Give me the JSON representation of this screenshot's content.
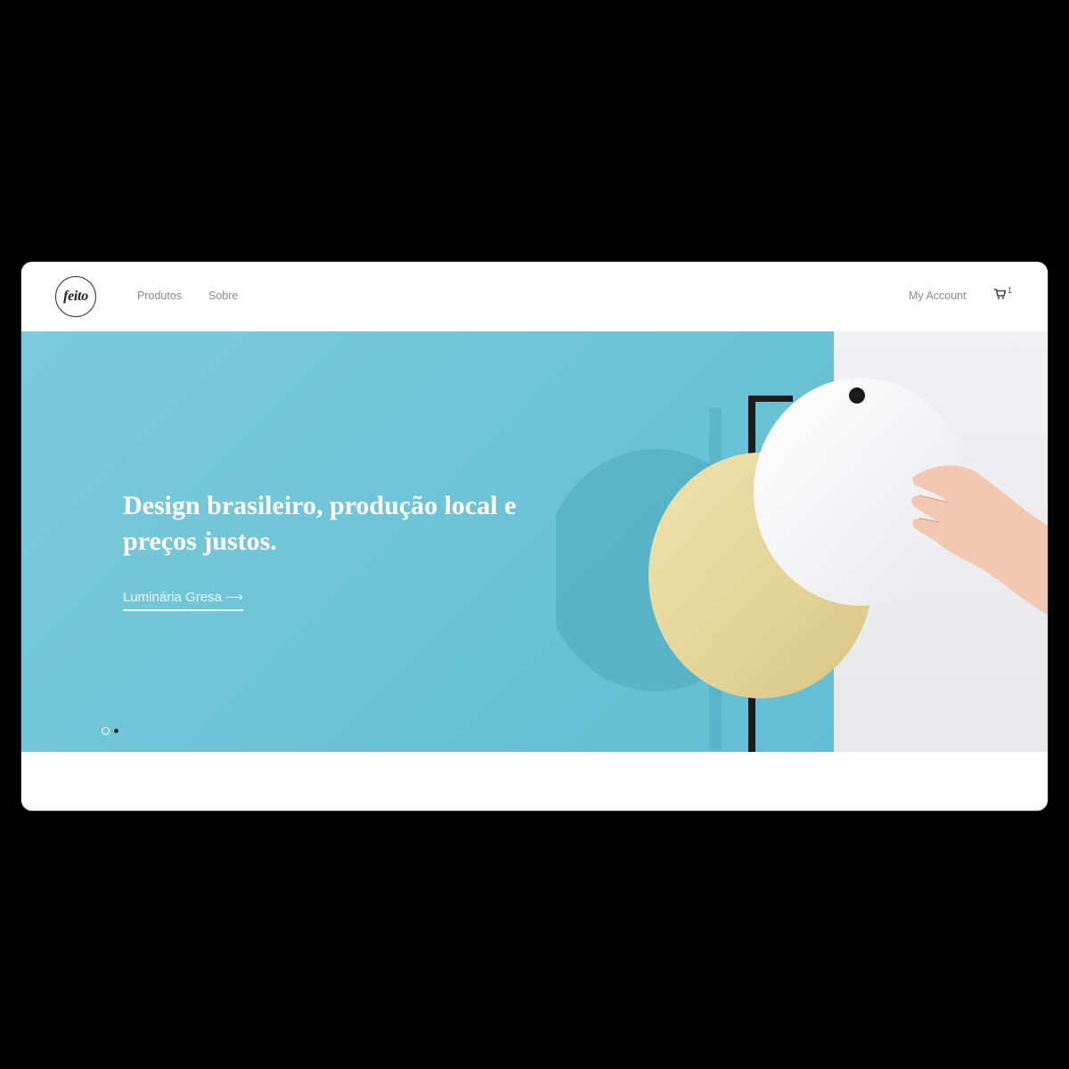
{
  "brand": {
    "logo_text": "feito"
  },
  "nav": {
    "links": [
      {
        "label": "Produtos"
      },
      {
        "label": "Sobre"
      }
    ],
    "account_label": "My Account",
    "cart_count": "1"
  },
  "hero": {
    "title": "Design brasileiro, produção local e preços justos.",
    "cta_label": "Luminária Gresa",
    "cta_arrow": "⟶",
    "slides": {
      "count": 2,
      "active": 1
    }
  },
  "colors": {
    "hero_background": "#68c1d5",
    "wall": "#efeef1",
    "brass": "#e7d9a1",
    "white_disc": "#f7f7f9"
  }
}
